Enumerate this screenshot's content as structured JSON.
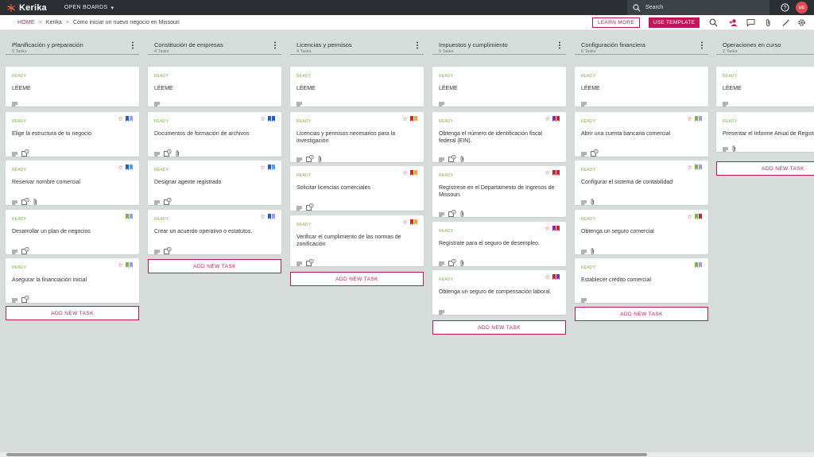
{
  "app": {
    "name": "Kerika",
    "open_boards": "OPEN BOARDS",
    "search_placeholder": "Search",
    "avatar_initials": "UG"
  },
  "breadcrumb": {
    "home": "HOME",
    "workspace": "Kerika",
    "board": "Cómo iniciar un nuevo negocio en Missouri"
  },
  "actions": {
    "learn_more": "LEARN MORE",
    "use_template": "USE TEMPLATE"
  },
  "colors": {
    "accent": "#c2185b",
    "ready": "#7cb342",
    "topbar": "#2b2f33"
  },
  "add_task_label": "ADD NEW TASK",
  "columns": [
    {
      "title": "Planificación y preparación",
      "count": "5 Tasks",
      "cards": [
        {
          "status": "READY",
          "title": "LÉEME"
        },
        {
          "status": "READY",
          "title": "Elige la estructura de tu negocio"
        },
        {
          "status": "READY",
          "title": "Reservar nombre comercial"
        },
        {
          "status": "READY",
          "title": "Desarrollar un plan de negocios"
        },
        {
          "status": "READY",
          "title": "Asegurar la financiación inicial"
        }
      ]
    },
    {
      "title": "Constitución de empresas",
      "count": "4 Tasks",
      "cards": [
        {
          "status": "READY",
          "title": "LÉEME"
        },
        {
          "status": "READY",
          "title": "Documentos de formación de archivos"
        },
        {
          "status": "READY",
          "title": "Designar agente registrado"
        },
        {
          "status": "READY",
          "title": "Crear un acuerdo operativo o estatutos."
        }
      ]
    },
    {
      "title": "Licencias y permisos",
      "count": "4 Tasks",
      "cards": [
        {
          "status": "READY",
          "title": "LÉEME"
        },
        {
          "status": "READY",
          "title": "Licencias y permisos necesarios para la investigación"
        },
        {
          "status": "READY",
          "title": "Solicitar licencias comerciales"
        },
        {
          "status": "READY",
          "title": "Verificar el cumplimiento de las normas de zonificación"
        }
      ]
    },
    {
      "title": "Impuestos y cumplimiento",
      "count": "5 Tasks",
      "cards": [
        {
          "status": "READY",
          "title": "LÉEME"
        },
        {
          "status": "READY",
          "title": "Obtenga el número de identificación fiscal federal (EIN)."
        },
        {
          "status": "READY",
          "title": "Regístrese en el Departamento de Ingresos de Missouri."
        },
        {
          "status": "READY",
          "title": "Regístrate para el seguro de desempleo."
        },
        {
          "status": "READY",
          "title": "Obtenga un seguro de compensación laboral."
        }
      ]
    },
    {
      "title": "Configuración financiera",
      "count": "5 Tasks",
      "cards": [
        {
          "status": "READY",
          "title": "LÉEME"
        },
        {
          "status": "READY",
          "title": "Abrir una cuenta bancaria comercial"
        },
        {
          "status": "READY",
          "title": "Configurar el sistema de contabilidad"
        },
        {
          "status": "READY",
          "title": "Obtenga un seguro comercial"
        },
        {
          "status": "READY",
          "title": "Establecer crédito comercial"
        }
      ]
    },
    {
      "title": "Operaciones en curso",
      "count": "2 Tasks",
      "cards": [
        {
          "status": "READY",
          "title": "LÉEME"
        },
        {
          "status": "READY",
          "title": "Presentar el Informe Anual de Registro"
        }
      ]
    }
  ]
}
